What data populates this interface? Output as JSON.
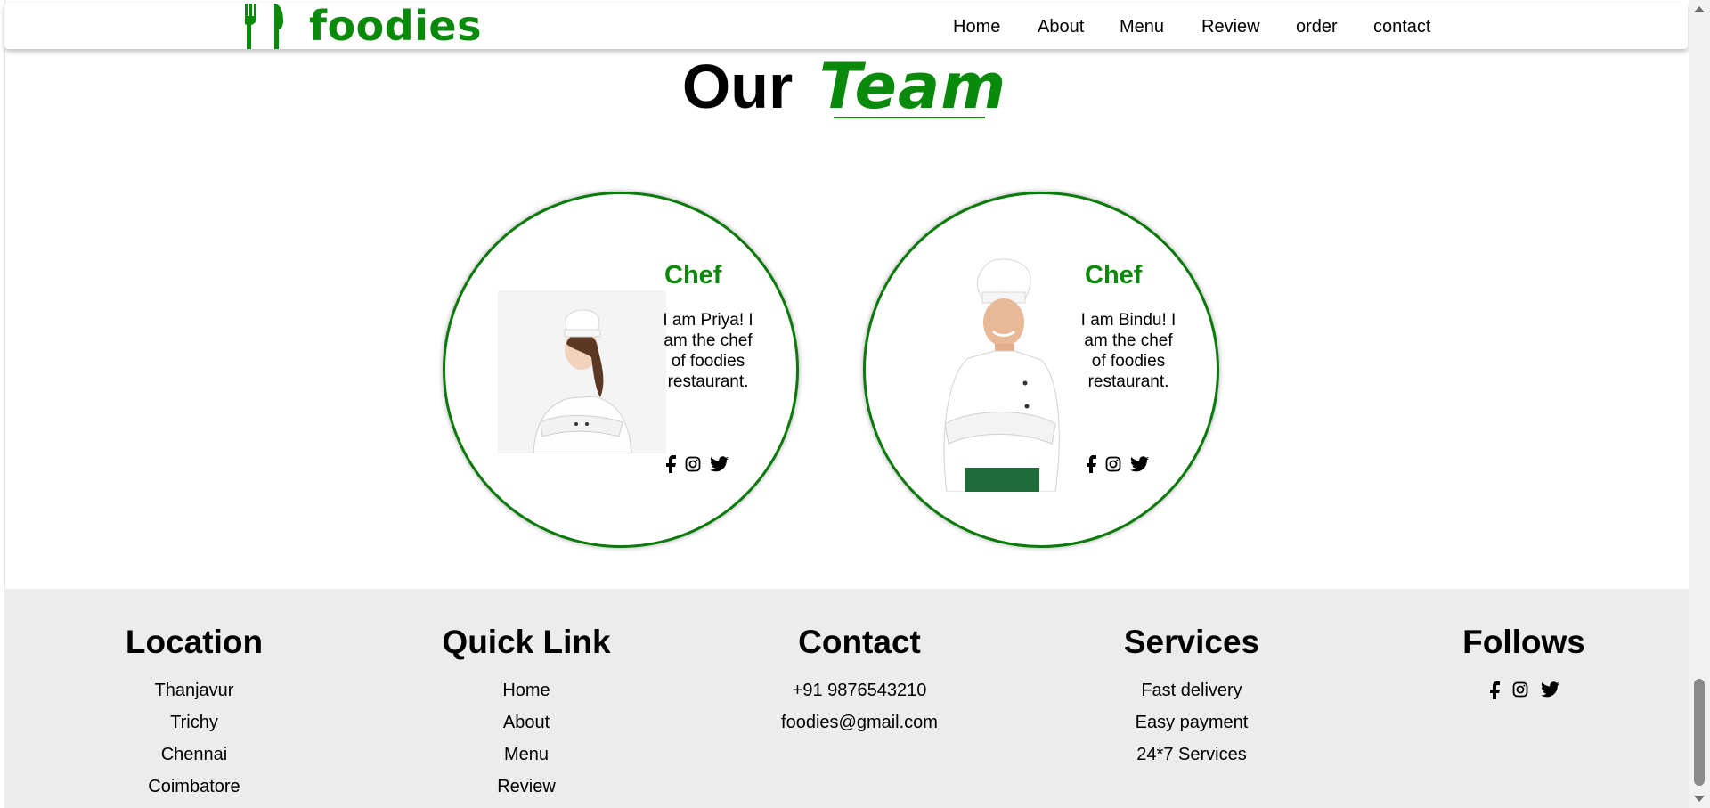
{
  "brand": {
    "name": "foodies",
    "logo_icon": "fork-knife-icon",
    "color": "#0a8a0a"
  },
  "nav": {
    "items": [
      {
        "label": "Home"
      },
      {
        "label": "About"
      },
      {
        "label": "Menu"
      },
      {
        "label": "Review"
      },
      {
        "label": "order"
      },
      {
        "label": "contact"
      }
    ]
  },
  "team_section": {
    "title_plain": "Our",
    "title_accent": "Team",
    "members": [
      {
        "role": "Chef",
        "bio": "I am Priya! I am the chef of foodies restaurant.",
        "photo": "female-chef-photo",
        "social": [
          "facebook-icon",
          "instagram-icon",
          "twitter-icon"
        ]
      },
      {
        "role": "Chef",
        "bio": "I am Bindu! I am the chef of foodies restaurant.",
        "photo": "male-chef-photo",
        "social": [
          "facebook-icon",
          "instagram-icon",
          "twitter-icon"
        ]
      }
    ]
  },
  "footer": {
    "location": {
      "heading": "Location",
      "items": [
        "Thanjavur",
        "Trichy",
        "Chennai",
        "Coimbatore"
      ]
    },
    "quick_link": {
      "heading": "Quick Link",
      "items": [
        "Home",
        "About",
        "Menu",
        "Review"
      ]
    },
    "contact": {
      "heading": "Contact",
      "items": [
        "+91 9876543210",
        "foodies@gmail.com"
      ]
    },
    "services": {
      "heading": "Services",
      "items": [
        "Fast delivery",
        "Easy payment",
        "24*7 Services"
      ]
    },
    "follows": {
      "heading": "Follows",
      "social": [
        "facebook-icon",
        "instagram-icon",
        "twitter-icon"
      ]
    }
  },
  "colors": {
    "accent": "#0a8a0a",
    "footer_bg": "#ececec",
    "circle_border": "#0a7a0a"
  }
}
